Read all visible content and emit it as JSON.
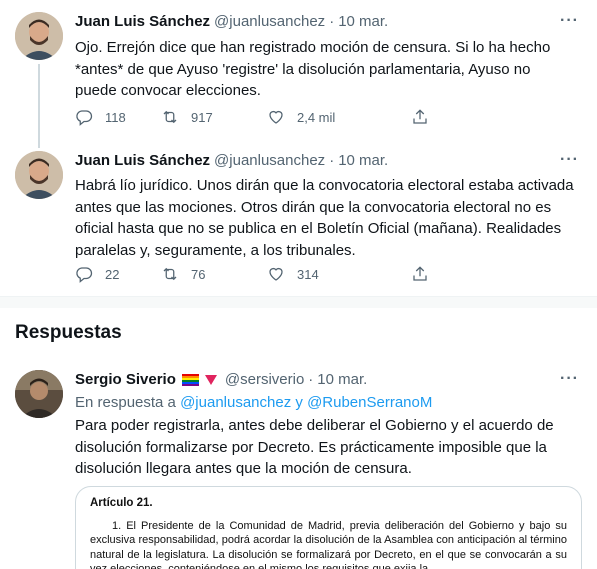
{
  "tweets": [
    {
      "name": "Juan Luis Sánchez",
      "handle": "@juanlusanchez",
      "time": "10 mar.",
      "text": "Ojo. Errejón dice que han registrado moción de censura. Si lo ha hecho *antes* de que Ayuso 'registre' la disolución parlamentaria, Ayuso no puede convocar elecciones.",
      "replies": "118",
      "retweets": "917",
      "likes": "2,4 mil"
    },
    {
      "name": "Juan Luis Sánchez",
      "handle": "@juanlusanchez",
      "time": "10 mar.",
      "text": "Habrá lío jurídico. Unos dirán que la convocatoria electoral estaba activada antes que las mociones. Otros dirán que la convocatoria electoral no es oficial hasta que no se publica en el Boletín Oficial (mañana). Realidades paralelas y, seguramente, a los tribunales.",
      "replies": "22",
      "retweets": "76",
      "likes": "314"
    }
  ],
  "section_title": "Respuestas",
  "reply": {
    "name": "Sergio Siverio",
    "handle": "@sersiverio",
    "time": "10 mar.",
    "reply_prefix": "En respuesta a",
    "reply_user1": "@juanlusanchez",
    "reply_conj": "y",
    "reply_user2": "@RubenSerranoM",
    "text": "Para poder registrarla, antes debe deliberar el Gobierno y el acuerdo de disolución formalizarse por Decreto. Es prácticamente imposible que la disolución llegara antes que la moción de censura.",
    "doc_title": "Artículo 21.",
    "doc_text": "1. El Presidente de la Comunidad de Madrid, previa deliberación del Gobierno y bajo su exclusiva responsabilidad, podrá acordar la disolución de la Asamblea con anticipación al término natural de la legislatura. La disolución se formalizará por Decreto, en el que se convocarán a su vez elecciones, conteniéndose en el mismo los requisitos que exija la"
  },
  "more_icon": "more-horizontal-icon",
  "colors": {
    "link": "#1d9bf0",
    "secondary": "#536471",
    "thread_line": "#cfd9de"
  }
}
